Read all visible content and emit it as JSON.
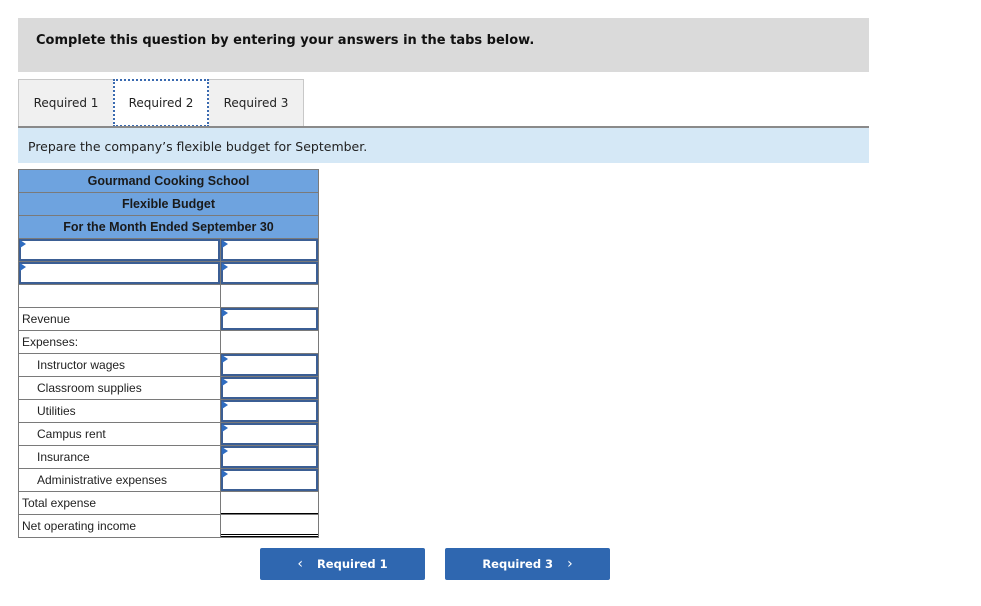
{
  "instruction": "Complete this question by entering your answers in the tabs below.",
  "tabs": [
    {
      "label": "Required 1",
      "active": false
    },
    {
      "label": "Required 2",
      "active": true
    },
    {
      "label": "Required 3",
      "active": false
    }
  ],
  "prompt": "Prepare the company’s flexible budget for September.",
  "budget": {
    "company": "Gourmand Cooking School",
    "title": "Flexible Budget",
    "period": "For the Month Ended September 30",
    "header_inputs": [
      {
        "label_value": "",
        "amount_value": ""
      },
      {
        "label_value": "",
        "amount_value": ""
      }
    ],
    "rows": {
      "revenue": {
        "label": "Revenue",
        "value": ""
      },
      "expenses_heading": "Expenses:",
      "expenses": [
        {
          "label": "Instructor wages",
          "value": ""
        },
        {
          "label": "Classroom supplies",
          "value": ""
        },
        {
          "label": "Utilities",
          "value": ""
        },
        {
          "label": "Campus rent",
          "value": ""
        },
        {
          "label": "Insurance",
          "value": ""
        },
        {
          "label": "Administrative expenses",
          "value": ""
        }
      ],
      "total_expense": {
        "label": "Total expense",
        "value": ""
      },
      "net_operating_income": {
        "label": "Net operating income",
        "value": ""
      }
    }
  },
  "nav": {
    "prev_label": "Required 1",
    "next_label": "Required 3",
    "prev_icon": "chevron-left-icon",
    "next_icon": "chevron-right-icon"
  },
  "colors": {
    "header_blue": "#6ea3df",
    "prompt_bg": "#d5e8f6",
    "button_blue": "#2f67b0",
    "input_border": "#3b5e94"
  }
}
